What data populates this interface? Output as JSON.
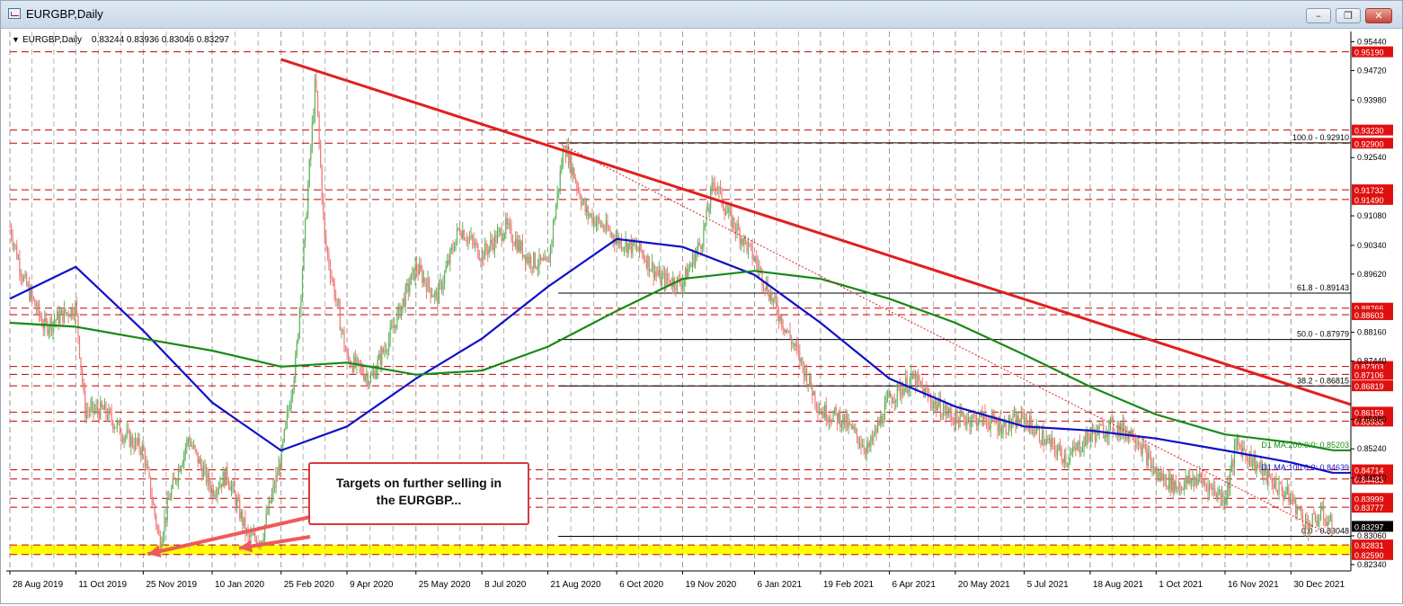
{
  "window": {
    "title": "EURGBP,Daily",
    "controls": [
      "minimize",
      "restore",
      "close"
    ]
  },
  "header": {
    "symbol_line": "EURGBP,Daily",
    "ohlc": "0.83244 0.83936 0.83046 0.83297"
  },
  "annotation": {
    "line1": "Targets on further selling in",
    "line2": "the EURGBP..."
  },
  "colors": {
    "trendline": "#e02020",
    "ma100": "#1010c8",
    "ma200": "#168a16",
    "bull_candle": "#5fb35f",
    "bear_candle": "#f07878",
    "level_line": "#c80000",
    "price_tag": "#e01010",
    "current_tag": "#000000",
    "support_zone": "#ffff00"
  },
  "chart_data": {
    "type": "line",
    "title": "EURGBP,Daily",
    "y_range": [
      0.8218,
      0.957
    ],
    "y_ticks": [
      "0.95440",
      "0.94720",
      "0.93980",
      "0.92540",
      "0.91080",
      "0.90340",
      "0.89620",
      "0.88160",
      "0.87440",
      "0.85980",
      "0.85240",
      "0.84510",
      "0.83060",
      "0.82340"
    ],
    "x_ticks": [
      "28 Aug 2019",
      "11 Oct 2019",
      "25 Nov 2019",
      "10 Jan 2020",
      "25 Feb 2020",
      "9 Apr 2020",
      "25 May 2020",
      "8 Jul 2020",
      "21 Aug 2020",
      "6 Oct 2020",
      "19 Nov 2020",
      "6 Jan 2021",
      "19 Feb 2021",
      "6 Apr 2021",
      "20 May 2021",
      "5 Jul 2021",
      "18 Aug 2021",
      "1 Oct 2021",
      "16 Nov 2021",
      "30 Dec 2021"
    ],
    "price_path": [
      {
        "x": "28 Aug 2019",
        "y": 0.908
      },
      {
        "x": "6 Sep 2019",
        "y": 0.895
      },
      {
        "x": "20 Sep 2019",
        "y": 0.883
      },
      {
        "x": "11 Oct 2019",
        "y": 0.888
      },
      {
        "x": "17 Oct 2019",
        "y": 0.862
      },
      {
        "x": "30 Oct 2019",
        "y": 0.862
      },
      {
        "x": "12 Nov 2019",
        "y": 0.856
      },
      {
        "x": "25 Nov 2019",
        "y": 0.852
      },
      {
        "x": "6 Dec 2019",
        "y": 0.829
      },
      {
        "x": "13 Dec 2019",
        "y": 0.841
      },
      {
        "x": "25 Dec 2019",
        "y": 0.855
      },
      {
        "x": "10 Jan 2020",
        "y": 0.842
      },
      {
        "x": "20 Jan 2020",
        "y": 0.846
      },
      {
        "x": "3 Feb 2020",
        "y": 0.83
      },
      {
        "x": "12 Feb 2020",
        "y": 0.83
      },
      {
        "x": "25 Feb 2020",
        "y": 0.85
      },
      {
        "x": "6 Mar 2020",
        "y": 0.875
      },
      {
        "x": "19 Mar 2020",
        "y": 0.945
      },
      {
        "x": "25 Mar 2020",
        "y": 0.905
      },
      {
        "x": "9 Apr 2020",
        "y": 0.875
      },
      {
        "x": "25 Apr 2020",
        "y": 0.87
      },
      {
        "x": "7 May 2020",
        "y": 0.88
      },
      {
        "x": "25 May 2020",
        "y": 0.898
      },
      {
        "x": "8 Jun 2020",
        "y": 0.89
      },
      {
        "x": "23 Jun 2020",
        "y": 0.908
      },
      {
        "x": "8 Jul 2020",
        "y": 0.901
      },
      {
        "x": "24 Jul 2020",
        "y": 0.908
      },
      {
        "x": "8 Aug 2020",
        "y": 0.9
      },
      {
        "x": "21 Aug 2020",
        "y": 0.898
      },
      {
        "x": "1 Sep 2020",
        "y": 0.929
      },
      {
        "x": "15 Sep 2020",
        "y": 0.912
      },
      {
        "x": "6 Oct 2020",
        "y": 0.905
      },
      {
        "x": "22 Oct 2020",
        "y": 0.902
      },
      {
        "x": "4 Nov 2020",
        "y": 0.895
      },
      {
        "x": "19 Nov 2020",
        "y": 0.894
      },
      {
        "x": "2 Dec 2020",
        "y": 0.905
      },
      {
        "x": "10 Dec 2020",
        "y": 0.92
      },
      {
        "x": "18 Dec 2020",
        "y": 0.912
      },
      {
        "x": "6 Jan 2021",
        "y": 0.9
      },
      {
        "x": "20 Jan 2021",
        "y": 0.888
      },
      {
        "x": "4 Feb 2021",
        "y": 0.876
      },
      {
        "x": "19 Feb 2021",
        "y": 0.862
      },
      {
        "x": "5 Mar 2021",
        "y": 0.86
      },
      {
        "x": "23 Mar 2021",
        "y": 0.852
      },
      {
        "x": "6 Apr 2021",
        "y": 0.865
      },
      {
        "x": "22 Apr 2021",
        "y": 0.87
      },
      {
        "x": "5 May 2021",
        "y": 0.864
      },
      {
        "x": "20 May 2021",
        "y": 0.86
      },
      {
        "x": "7 Jun 2021",
        "y": 0.86
      },
      {
        "x": "22 Jun 2021",
        "y": 0.858
      },
      {
        "x": "5 Jul 2021",
        "y": 0.86
      },
      {
        "x": "20 Jul 2021",
        "y": 0.854
      },
      {
        "x": "3 Aug 2021",
        "y": 0.85
      },
      {
        "x": "18 Aug 2021",
        "y": 0.856
      },
      {
        "x": "2 Sep 2021",
        "y": 0.858
      },
      {
        "x": "17 Sep 2021",
        "y": 0.856
      },
      {
        "x": "1 Oct 2021",
        "y": 0.846
      },
      {
        "x": "15 Oct 2021",
        "y": 0.843
      },
      {
        "x": "29 Oct 2021",
        "y": 0.845
      },
      {
        "x": "16 Nov 2021",
        "y": 0.84
      },
      {
        "x": "24 Nov 2021",
        "y": 0.854
      },
      {
        "x": "3 Dec 2021",
        "y": 0.85
      },
      {
        "x": "15 Dec 2021",
        "y": 0.845
      },
      {
        "x": "30 Dec 2021",
        "y": 0.84
      },
      {
        "x": "10 Jan 2022",
        "y": 0.833
      },
      {
        "x": "20 Jan 2022",
        "y": 0.836
      },
      {
        "x": "27 Jan 2022",
        "y": 0.833
      }
    ],
    "series": [
      {
        "name": "D1 MA:100:0:0: 0.84639",
        "color": "#1010c8",
        "points": [
          {
            "x": "28 Aug 2019",
            "y": 0.89
          },
          {
            "x": "11 Oct 2019",
            "y": 0.898
          },
          {
            "x": "25 Nov 2019",
            "y": 0.882
          },
          {
            "x": "10 Jan 2020",
            "y": 0.864
          },
          {
            "x": "25 Feb 2020",
            "y": 0.852
          },
          {
            "x": "9 Apr 2020",
            "y": 0.858
          },
          {
            "x": "25 May 2020",
            "y": 0.87
          },
          {
            "x": "8 Jul 2020",
            "y": 0.88
          },
          {
            "x": "21 Aug 2020",
            "y": 0.893
          },
          {
            "x": "6 Oct 2020",
            "y": 0.905
          },
          {
            "x": "19 Nov 2020",
            "y": 0.903
          },
          {
            "x": "6 Jan 2021",
            "y": 0.896
          },
          {
            "x": "19 Feb 2021",
            "y": 0.884
          },
          {
            "x": "6 Apr 2021",
            "y": 0.87
          },
          {
            "x": "20 May 2021",
            "y": 0.863
          },
          {
            "x": "5 Jul 2021",
            "y": 0.858
          },
          {
            "x": "18 Aug 2021",
            "y": 0.857
          },
          {
            "x": "1 Oct 2021",
            "y": 0.855
          },
          {
            "x": "16 Nov 2021",
            "y": 0.852
          },
          {
            "x": "30 Dec 2021",
            "y": 0.849
          },
          {
            "x": "27 Jan 2022",
            "y": 0.84639
          }
        ]
      },
      {
        "name": "D1 MA:200:0:0: 0.85203",
        "color": "#168a16",
        "points": [
          {
            "x": "28 Aug 2019",
            "y": 0.884
          },
          {
            "x": "11 Oct 2019",
            "y": 0.883
          },
          {
            "x": "25 Nov 2019",
            "y": 0.88
          },
          {
            "x": "10 Jan 2020",
            "y": 0.877
          },
          {
            "x": "25 Feb 2020",
            "y": 0.873
          },
          {
            "x": "9 Apr 2020",
            "y": 0.874
          },
          {
            "x": "25 May 2020",
            "y": 0.871
          },
          {
            "x": "8 Jul 2020",
            "y": 0.872
          },
          {
            "x": "21 Aug 2020",
            "y": 0.878
          },
          {
            "x": "6 Oct 2020",
            "y": 0.887
          },
          {
            "x": "19 Nov 2020",
            "y": 0.895
          },
          {
            "x": "6 Jan 2021",
            "y": 0.897
          },
          {
            "x": "19 Feb 2021",
            "y": 0.895
          },
          {
            "x": "6 Apr 2021",
            "y": 0.89
          },
          {
            "x": "20 May 2021",
            "y": 0.884
          },
          {
            "x": "5 Jul 2021",
            "y": 0.876
          },
          {
            "x": "18 Aug 2021",
            "y": 0.868
          },
          {
            "x": "1 Oct 2021",
            "y": 0.861
          },
          {
            "x": "16 Nov 2021",
            "y": 0.856
          },
          {
            "x": "30 Dec 2021",
            "y": 0.854
          },
          {
            "x": "27 Jan 2022",
            "y": 0.85203
          }
        ]
      }
    ],
    "trendlines": [
      {
        "from": {
          "x": "25 Feb 2020",
          "y": 0.95
        },
        "to": {
          "x": "8 Feb 2022",
          "y": 0.8635
        },
        "color": "#e02020"
      },
      {
        "from": {
          "x": "28 Aug 2020",
          "y": 0.9291
        },
        "to": {
          "x": "27 Jan 2022",
          "y": 0.8305
        },
        "color": "#e02020",
        "style": "dotted"
      }
    ],
    "fibonacci": [
      {
        "label": "100.0 - 0.92910",
        "value": 0.9291
      },
      {
        "label": "61.8 - 0.89143",
        "value": 0.89143
      },
      {
        "label": "50.0 - 0.87979",
        "value": 0.87979
      },
      {
        "label": "38.2 - 0.86815",
        "value": 0.86815
      },
      {
        "label": "0.0 - 0.83048",
        "value": 0.83048
      }
    ],
    "levels": [
      {
        "label": "0.95190",
        "value": 0.9519
      },
      {
        "label": "0.93230",
        "value": 0.9323
      },
      {
        "label": "0.92900",
        "value": 0.929
      },
      {
        "label": "0.91732",
        "value": 0.91732
      },
      {
        "label": "0.91490",
        "value": 0.9149
      },
      {
        "label": "0.88766",
        "value": 0.88766
      },
      {
        "label": "0.88603",
        "value": 0.88603
      },
      {
        "label": "0.87303",
        "value": 0.87303
      },
      {
        "label": "0.87106",
        "value": 0.87106
      },
      {
        "label": "0.86819",
        "value": 0.86819
      },
      {
        "label": "0.86159",
        "value": 0.86159
      },
      {
        "label": "0.85935",
        "value": 0.85935
      },
      {
        "label": "0.84714",
        "value": 0.84714
      },
      {
        "label": "0.84483",
        "value": 0.84483
      },
      {
        "label": "0.83999",
        "value": 0.83999
      },
      {
        "label": "0.83777",
        "value": 0.83777
      },
      {
        "label": "0.82831",
        "value": 0.82831
      },
      {
        "label": "0.82590",
        "value": 0.8259
      }
    ],
    "current_price": {
      "label": "0.83297",
      "value": 0.83297
    },
    "support_zone": [
      0.8259,
      0.8283
    ],
    "ma_labels": [
      {
        "text": "D1 MA:200:0:0: 0.85203",
        "value": 0.85203
      },
      {
        "text": "D1 MA:100:0:0: 0.84639",
        "value": 0.84639
      }
    ],
    "arrows": [
      {
        "to": {
          "x": "28 Nov 2019",
          "y": 0.826
        }
      },
      {
        "to": {
          "x": "28 Jan 2020",
          "y": 0.8275
        }
      }
    ]
  }
}
